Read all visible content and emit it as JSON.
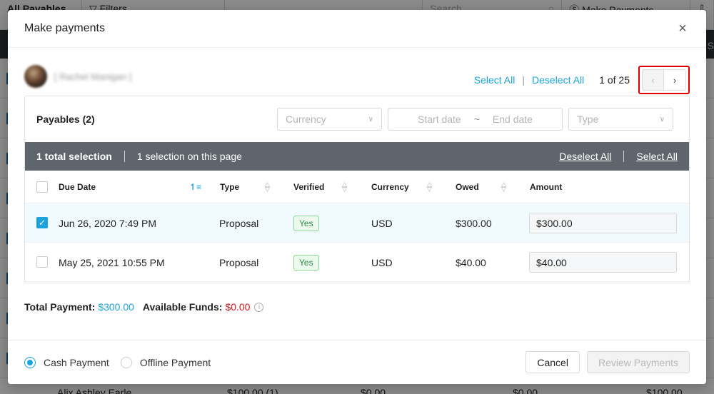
{
  "background": {
    "toolbar": {
      "title": "All Payables",
      "filters_label": "Filters",
      "search_placeholder": "Search",
      "make_payments_label": "Make Payments"
    },
    "last_row": {
      "name": "Alix Ashley Earle",
      "col1": "$100.00 (1)",
      "col2": "$0.00",
      "col3": "$0.00",
      "col4": "$100.00"
    }
  },
  "modal": {
    "title": "Make payments",
    "close_icon": "×",
    "user": {
      "name": "[ Rachel Manigan ]"
    },
    "select_all": "Select All",
    "deselect_all": "Deselect All",
    "separator": "|",
    "page_info": "1 of 25",
    "prev_icon": "‹",
    "next_icon": "›",
    "payables": {
      "title": "Payables (2)",
      "filters": {
        "currency_placeholder": "Currency",
        "start_date_placeholder": "Start date",
        "date_separator": "~",
        "end_date_placeholder": "End date",
        "type_placeholder": "Type"
      },
      "selection_bar": {
        "total": "1 total selection",
        "on_page": "1 selection on this page",
        "deselect_all": "Deselect All",
        "select_all": "Select All"
      },
      "columns": [
        "Due Date",
        "Type",
        "Verified",
        "Currency",
        "Owed",
        "Amount"
      ],
      "rows": [
        {
          "checked": true,
          "due_date": "Jun 26, 2020 7:49 PM",
          "type": "Proposal",
          "verified": "Yes",
          "currency": "USD",
          "owed": "$300.00",
          "amount": "$300.00"
        },
        {
          "checked": false,
          "due_date": "May 25, 2021 10:55 PM",
          "type": "Proposal",
          "verified": "Yes",
          "currency": "USD",
          "owed": "$40.00",
          "amount": "$40.00"
        }
      ]
    },
    "totals": {
      "total_label": "Total Payment:",
      "total_value": "$300.00",
      "funds_label": "Available Funds:",
      "funds_value": "$0.00",
      "info_icon": "i"
    },
    "footer": {
      "payment_methods": [
        {
          "label": "Cash Payment",
          "selected": true
        },
        {
          "label": "Offline Payment",
          "selected": false
        }
      ],
      "cancel_label": "Cancel",
      "review_label": "Review Payments"
    }
  },
  "colors": {
    "accent": "#1aa3dc",
    "danger": "#d9151c",
    "selection_bar": "#5f656d",
    "highlight_outline": "#e00000"
  }
}
